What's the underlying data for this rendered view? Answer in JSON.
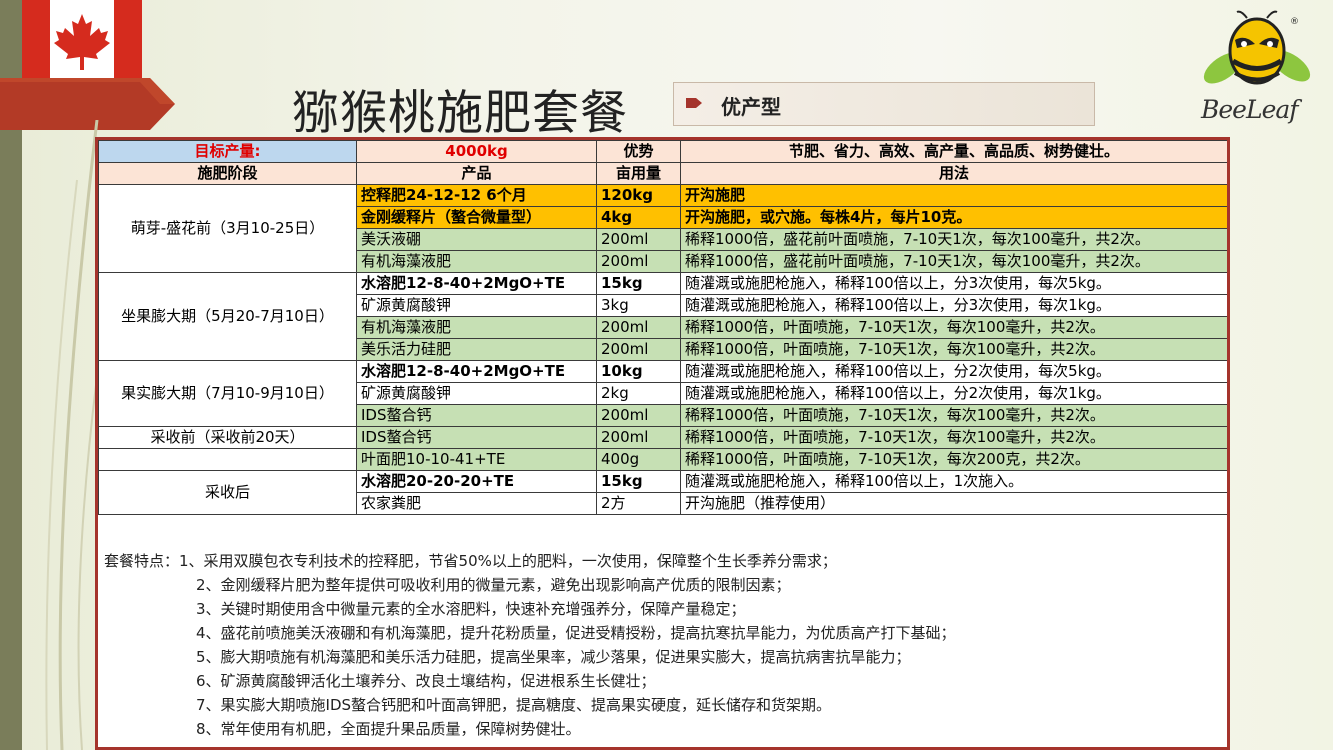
{
  "title": "猕猴桃施肥套餐",
  "tag": "优产型",
  "logo_text": "BeeLeaf",
  "colors": {
    "orange": "#ffc000",
    "green": "#c6e0b4",
    "peach": "#fce4d6",
    "blue": "#bdd7ee",
    "border_red": "#a5342c"
  },
  "header": {
    "target_label": "目标产量:",
    "target_value": "4000kg",
    "advantage_label": "优势",
    "advantage_text": "节肥、省力、高效、高产量、高品质、树势健壮。",
    "col_stage": "施肥阶段",
    "col_product": "产品",
    "col_amount": "亩用量",
    "col_usage": "用法"
  },
  "stages": [
    "萌芽-盛花前（3月10-25日）",
    "坐果膨大期（5月20-7月10日）",
    "果实膨大期（7月10-9月10日）",
    "采收前（采收前20天）",
    "采收后"
  ],
  "rows": [
    {
      "product": "控释肥24-12-12 6个月",
      "amount": "120kg",
      "usage": "开沟施肥"
    },
    {
      "product": "金刚缓释片（螯合微量型）",
      "amount": "4kg",
      "usage": "开沟施肥，或穴施。每株4片，每片10克。"
    },
    {
      "product": "美沃液硼",
      "amount": "200ml",
      "usage": "稀释1000倍，盛花前叶面喷施，7-10天1次，每次100毫升，共2次。"
    },
    {
      "product": "有机海藻液肥",
      "amount": "200ml",
      "usage": "稀释1000倍，盛花前叶面喷施，7-10天1次，每次100毫升，共2次。"
    },
    {
      "product": "水溶肥12-8-40+2MgO+TE",
      "amount": "15kg",
      "usage": "随灌溉或施肥枪施入，稀释100倍以上，分3次使用，每次5kg。"
    },
    {
      "product": "矿源黄腐酸钾",
      "amount": "3kg",
      "usage": "随灌溉或施肥枪施入，稀释100倍以上，分3次使用，每次1kg。"
    },
    {
      "product": "有机海藻液肥",
      "amount": "200ml",
      "usage": "稀释1000倍，叶面喷施，7-10天1次，每次100毫升，共2次。"
    },
    {
      "product": "美乐活力硅肥",
      "amount": "200ml",
      "usage": "稀释1000倍，叶面喷施，7-10天1次，每次100毫升，共2次。"
    },
    {
      "product": "水溶肥12-8-40+2MgO+TE",
      "amount": "10kg",
      "usage": "随灌溉或施肥枪施入，稀释100倍以上，分2次使用，每次5kg。"
    },
    {
      "product": "矿源黄腐酸钾",
      "amount": "2kg",
      "usage": "随灌溉或施肥枪施入，稀释100倍以上，分2次使用，每次1kg。"
    },
    {
      "product": "IDS螯合钙",
      "amount": "200ml",
      "usage": "稀释1000倍，叶面喷施，7-10天1次，每次100毫升，共2次。"
    },
    {
      "product": "IDS螯合钙",
      "amount": "200ml",
      "usage": "稀释1000倍，叶面喷施，7-10天1次，每次100毫升，共2次。"
    },
    {
      "product": "叶面肥10-10-41+TE",
      "amount": "400g",
      "usage": "稀释1000倍，叶面喷施，7-10天1次，每次200克，共2次。"
    },
    {
      "product": "水溶肥20-20-20+TE",
      "amount": "15kg",
      "usage": "随灌溉或施肥枪施入，稀释100倍以上，1次施入。"
    },
    {
      "product": "农家粪肥",
      "amount": "2方",
      "usage": "开沟施肥（推荐使用）"
    }
  ],
  "notes": [
    "套餐特点：1、采用双膜包衣专利技术的控释肥，节省50%以上的肥料，一次使用，保障整个生长季养分需求；",
    "2、金刚缓释片肥为整年提供可吸收利用的微量元素，避免出现影响高产优质的限制因素；",
    "3、关键时期使用含中微量元素的全水溶肥料，快速补充增强养分，保障产量稳定；",
    "4、盛花前喷施美沃液硼和有机海藻肥，提升花粉质量，促进受精授粉，提高抗寒抗旱能力，为优质高产打下基础；",
    "5、膨大期喷施有机海藻肥和美乐活力硅肥，提高坐果率，减少落果，促进果实膨大，提高抗病害抗旱能力；",
    "6、矿源黄腐酸钾活化土壤养分、改良土壤结构，促进根系生长健壮；",
    "7、果实膨大期喷施IDS螯合钙肥和叶面高钾肥，提高糖度、提高果实硬度，延长储存和货架期。",
    "8、常年使用有机肥，全面提升果品质量，保障树势健壮。"
  ]
}
